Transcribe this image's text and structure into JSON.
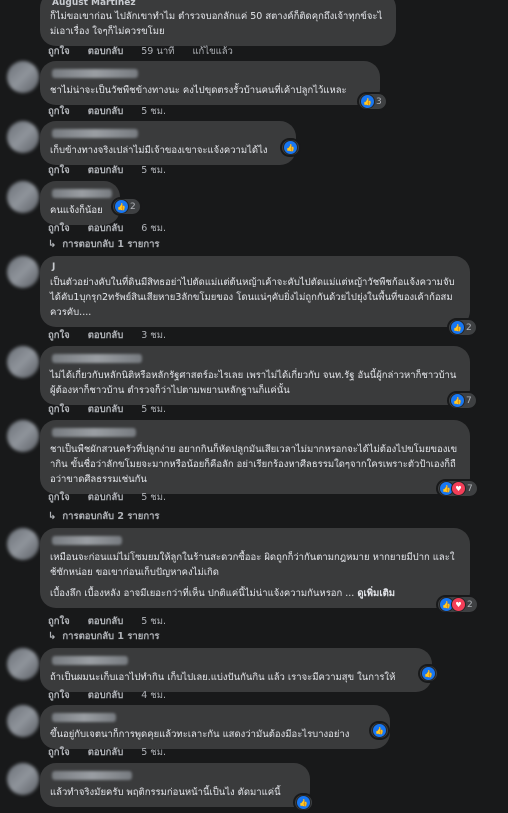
{
  "labels": {
    "like": "ถูกใจ",
    "reply": "ตอบกลับ",
    "edited": "แก้ไขแล้ว",
    "see_more": "ดูเพิ่มเติม"
  },
  "comments": [
    {
      "name": "August Martinez",
      "text": "ก็ไม่ขอเขาก่อน ไปลักเขาทำไม ตำรวจบอกลักแค่ 50 สตางค์ก็ติดคุกถึงเจ้าทุกข์จะไม่เอาเรื่อง ใจๆก็ไม่ควรขโมย",
      "time": "59 นาที",
      "edited": true
    },
    {
      "text": "ชาไม่น่าจะเป็นวัชพืชข้างทางนะ คงไปขุดตรงรั้วบ้านคนที่เค้าปลูกไว้แหละ",
      "time": "5 ชม.",
      "reactions": "3"
    },
    {
      "text": "เก็บข้างทางจริงเปล่าไม่มีเจ้าของเขาจะแจ้งความได้ไง",
      "time": "5 ชม.",
      "reactions": ""
    },
    {
      "text": "คนแจ้งก็น้อย",
      "time": "6 ชม.",
      "reactions": "2",
      "replies": "การตอบกลับ 1 รายการ"
    },
    {
      "name": "J",
      "text": "เป็นตัวอย่างคับในที่ดินมีสิทธอย่าไปตัดแม่แต่ต้นหญ้าเค้าจะคับไปตัดแม่แต่หญ้าวัชพืชก้อแจ้งความจับได้คับ1บุกรุก2ทรัพย์สินเสียหาย3ลักขโมยของ โดนแน่ๆคับยิ่งไม่ถูกกันด้วยไปยุ่งในพื้นที่ของเค้าก้อสมควรคับ....",
      "time": "3 ชม.",
      "reactions": "2"
    },
    {
      "name": "N",
      "text": "ไม่ได้เกี่ยวกับหลักนิติหรือหลักรัฐศาสตร์อะไรเลย เพราไม่ได้เกี่ยวกับ จนท.รัฐ อันนี้ผู้กล่าวหาก็ชาวบ้าน ผู้ต้องหาก็ชาวบ้าน ตำรวจก็ว่าไปตามพยานหลักฐานก็แค่นั้น",
      "time": "5 ชม.",
      "reactions": "7"
    },
    {
      "text": "ชาเป็นพืชผักสวนครัวที่ปลูกง่าย อยากกินก็หัดปลูกมันเสียเวลาไม่มากหรอกจะได้ไม่ต้องไปขโมยของเขากิน ขั้นชื่อว่าลักขโมยจะมากหรือน้อยก็คือลัก อย่าเรียกร้องหาศีลธรรมใดๆจากใครเพราะตัวป้าเองก็ถือว่าขาดศีลธรรมเช่นกัน",
      "time": "5 ชม.",
      "reactions": "7",
      "replies": "การตอบกลับ 2 รายการ"
    },
    {
      "text": "เหมือนจะก่อนแม่ไม่โซมยมให้ลูกในร้านสะดวกซื้ออะ ผิดถูกก็ว่ากันตามกฎหมาย หากยายมีปาก และใช้ซักหน่อย ขอเขาก่อนเก็บปัญหาคงไม่เกิด",
      "text2": "เบื้องลึก เบื้องหลัง อาจมีเยอะกว่าที่เห็น ปกติแค่นี้ไม่น่าแจ้งความกันหรอก ...",
      "time": "5 ชม.",
      "reactions": "2",
      "replies": "การตอบกลับ 1 รายการ"
    },
    {
      "text": "ถ้าเป็นผมนะเก็บเอาไปทำกิน เก็บไปเลย.แบ่งปันกันกิน แล้ว เราจะมีความสุข ในการให้",
      "time": "4 ชม.",
      "reactions": ""
    },
    {
      "text": "ขึ้นอยู่กับเจตนาก็การพูดคุยแล้วทะเลาะกัน แสดงว่ามันต้องมีอะไรบางอย่าง",
      "time": "5 ชม.",
      "reactions": ""
    },
    {
      "text": "แล้วทำจริงมัยครับ พฤติกรรมก่อนหน้านี้เป็นไง ตัดมาแค่นี้",
      "time": "",
      "reactions": ""
    }
  ]
}
